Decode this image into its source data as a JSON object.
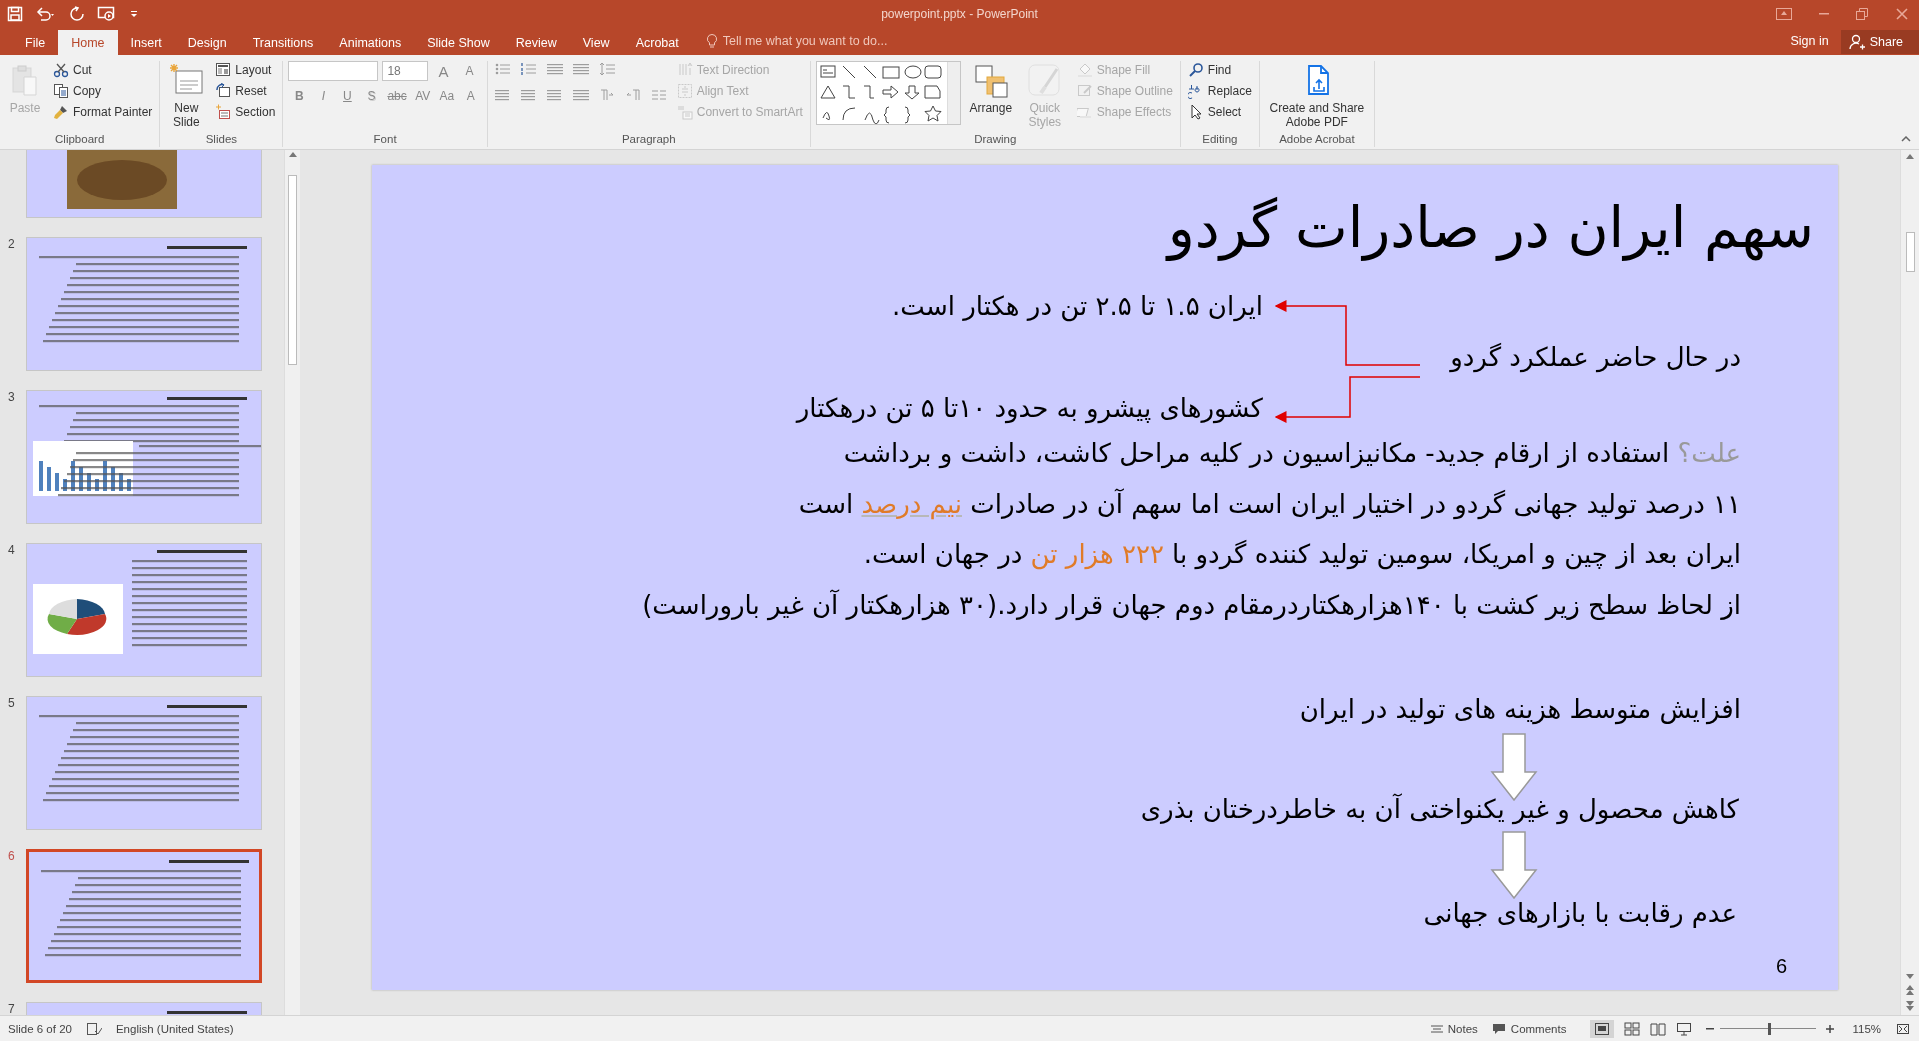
{
  "window": {
    "title": "powerpoint.pptx - PowerPoint"
  },
  "menu_tabs": [
    {
      "label": "File",
      "selected": false
    },
    {
      "label": "Home",
      "selected": true
    },
    {
      "label": "Insert",
      "selected": false
    },
    {
      "label": "Design",
      "selected": false
    },
    {
      "label": "Transitions",
      "selected": false
    },
    {
      "label": "Animations",
      "selected": false
    },
    {
      "label": "Slide Show",
      "selected": false
    },
    {
      "label": "Review",
      "selected": false
    },
    {
      "label": "View",
      "selected": false
    },
    {
      "label": "Acrobat",
      "selected": false
    }
  ],
  "tell_me": {
    "placeholder": "Tell me what you want to do..."
  },
  "account": {
    "sign_in": "Sign in",
    "share": "Share"
  },
  "ribbon": {
    "groups": [
      {
        "kind": "clipboard",
        "label": "Clipboard",
        "large": {
          "label": "Paste",
          "disabled": true
        },
        "small": [
          {
            "label": "Cut",
            "disabled": false
          },
          {
            "label": "Copy",
            "disabled": false
          },
          {
            "label": "Format Painter",
            "disabled": false
          }
        ]
      },
      {
        "kind": "slides",
        "label": "Slides",
        "large": {
          "label": "New Slide",
          "disabled": false
        },
        "small": [
          {
            "label": "Layout",
            "disabled": false
          },
          {
            "label": "Reset",
            "disabled": false
          },
          {
            "label": "Section",
            "disabled": false
          }
        ]
      },
      {
        "kind": "font",
        "label": "Font",
        "size": "18",
        "size_buttons": [
          "A",
          "A"
        ],
        "format_buttons": [
          "B",
          "I",
          "U",
          "S",
          "abc",
          "AV",
          "Aa",
          "A"
        ]
      },
      {
        "kind": "paragraph",
        "label": "Paragraph",
        "small": [
          {
            "label": "Text Direction",
            "disabled": true
          },
          {
            "label": "Align Text",
            "disabled": true
          },
          {
            "label": "Convert to SmartArt",
            "disabled": true
          }
        ]
      },
      {
        "kind": "drawing",
        "label": "Drawing",
        "large": [
          {
            "label": "Arrange",
            "disabled": false
          },
          {
            "label": "Quick Styles",
            "disabled": true
          }
        ],
        "small": [
          {
            "label": "Shape Fill",
            "disabled": true
          },
          {
            "label": "Shape Outline",
            "disabled": true
          },
          {
            "label": "Shape Effects",
            "disabled": true
          }
        ]
      },
      {
        "kind": "editing",
        "label": "Editing",
        "small": [
          {
            "label": "Find",
            "disabled": false
          },
          {
            "label": "Replace",
            "disabled": false
          },
          {
            "label": "Select",
            "disabled": false
          }
        ]
      },
      {
        "kind": "acrobat",
        "label": "Adobe Acrobat",
        "large": {
          "label": "Create and Share Adobe PDF",
          "disabled": false
        }
      }
    ]
  },
  "thumbnails": [
    {
      "kind": "photo",
      "selected": false
    },
    {
      "number": "2",
      "kind": "text",
      "selected": false
    },
    {
      "number": "3",
      "kind": "chart",
      "selected": false
    },
    {
      "number": "4",
      "kind": "pie",
      "selected": false
    },
    {
      "number": "5",
      "kind": "text",
      "selected": false
    },
    {
      "number": "6",
      "kind": "text",
      "selected": true
    },
    {
      "number": "7",
      "kind": "text",
      "selected": false
    }
  ],
  "slide": {
    "title": "سهم ایران در صادرات گردو",
    "callout": {
      "top": "ایران ۱.۵ تا ۲.۵ تن در هکتار است.",
      "center": "در حال حاضر عملکرد گردو",
      "bottom": "کشورهای پیشرو به حدود ۱۰تا ۵ تن درهکتار"
    },
    "paragraphs": [
      {
        "segments": [
          {
            "kind": "muted",
            "text": "علت؟"
          },
          {
            "kind": "normal",
            "text": "  استفاده از ارقام جدید- مکانیزاسیون در کلیه مراحل کاشت، داشت و برداشت"
          }
        ]
      },
      {
        "segments": [
          {
            "kind": "normal",
            "text": "۱۱ درصد تولید جهانی گردو در اختیار ایران است اما سهم آن در صادرات "
          },
          {
            "kind": "accent_underlined",
            "text": "نیم درصد"
          },
          {
            "kind": "normal",
            "text": " است"
          }
        ]
      },
      {
        "segments": [
          {
            "kind": "normal",
            "text": "ایران بعد از چین و امریکا، سومین تولید کننده گردو با "
          },
          {
            "kind": "accent",
            "text": "۲۲۲ هزار تن"
          },
          {
            "kind": "normal",
            "text": " در جهان  است."
          }
        ]
      },
      {
        "segments": [
          {
            "kind": "normal",
            "text": "از لحاظ سطح زیر کشت با ۱۴۰هزارهکتاردرمقام دوم جهان قرار دارد.(۳۰ هزارهکتار آن غیر باروراست)"
          }
        ]
      }
    ],
    "flow": [
      "افزایش متوسط هزینه های تولید در ایران",
      "کاهش محصول و غیر یکنواختی آن به خاطردرختان بذری",
      "عدم رقابت با بازارهای جهانی"
    ],
    "number": "6"
  },
  "status_bar": {
    "slide_position": "Slide 6 of 20",
    "language": "English (United States)",
    "notes": "Notes",
    "comments": "Comments",
    "zoom": "115%",
    "zoom_slider": {
      "level": 0.51
    }
  }
}
